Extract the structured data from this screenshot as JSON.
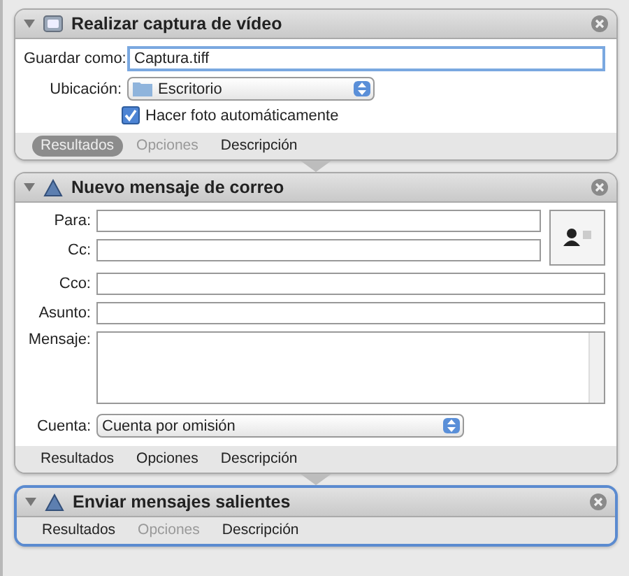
{
  "actions": [
    {
      "kind": "video",
      "title": "Realizar captura de vídeo",
      "selected": false,
      "expanded": true,
      "save_as": {
        "label": "Guardar como:",
        "value": "Captura.tiff"
      },
      "location": {
        "label": "Ubicación:",
        "value": "Escritorio"
      },
      "auto_photo": {
        "label": "Hacer foto automáticamente",
        "checked": true
      },
      "footer": [
        {
          "label": "Resultados",
          "selected": true,
          "disabled": false
        },
        {
          "label": "Opciones",
          "selected": false,
          "disabled": true
        },
        {
          "label": "Descripción",
          "selected": false,
          "disabled": false
        }
      ]
    },
    {
      "kind": "mail",
      "title": "Nuevo mensaje de correo",
      "selected": false,
      "expanded": true,
      "fields": [
        {
          "label": "Para:"
        },
        {
          "label": "Cc:"
        },
        {
          "label": "Cco:"
        },
        {
          "label": "Asunto:"
        }
      ],
      "message": {
        "label": "Mensaje:"
      },
      "account": {
        "label": "Cuenta:",
        "value": "Cuenta por omisión"
      },
      "footer": [
        {
          "label": "Resultados",
          "selected": false,
          "disabled": false
        },
        {
          "label": "Opciones",
          "selected": false,
          "disabled": false
        },
        {
          "label": "Descripción",
          "selected": false,
          "disabled": false
        }
      ]
    },
    {
      "kind": "send",
      "title": "Enviar mensajes salientes",
      "selected": true,
      "expanded": true,
      "footer": [
        {
          "label": "Resultados",
          "selected": false,
          "disabled": false
        },
        {
          "label": "Opciones",
          "selected": false,
          "disabled": true
        },
        {
          "label": "Descripción",
          "selected": false,
          "disabled": false
        }
      ]
    }
  ]
}
